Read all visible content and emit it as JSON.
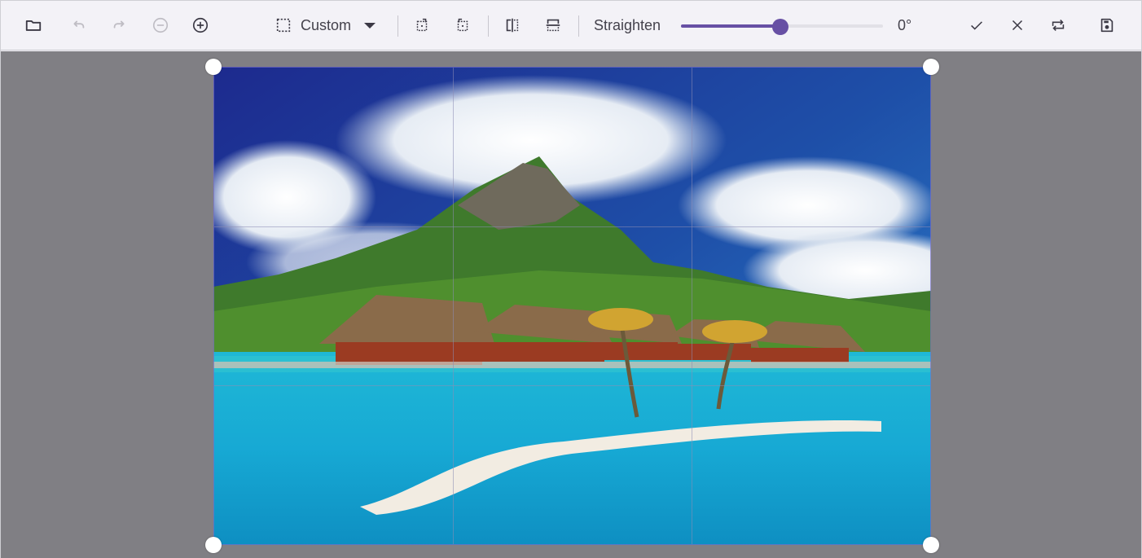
{
  "toolbar": {
    "open": {
      "icon": "folder-icon",
      "enabled": true
    },
    "undo": {
      "icon": "undo-icon",
      "enabled": false
    },
    "redo": {
      "icon": "redo-icon",
      "enabled": false
    },
    "zoom_out": {
      "icon": "zoom-out-icon",
      "enabled": false
    },
    "zoom_in": {
      "icon": "zoom-in-icon",
      "enabled": true
    },
    "aspect_ratio": {
      "icon": "crop-selection-icon",
      "selected": "Custom"
    },
    "rotate_left": {
      "icon": "rotate-left-icon"
    },
    "rotate_right": {
      "icon": "rotate-right-icon"
    },
    "flip_horizontal": {
      "icon": "flip-horizontal-icon"
    },
    "flip_vertical": {
      "icon": "flip-vertical-icon"
    },
    "straighten": {
      "label": "Straighten",
      "value_text": "0°",
      "slider_fraction": 0.49
    },
    "apply": {
      "icon": "check-icon"
    },
    "cancel": {
      "icon": "close-icon"
    },
    "reset": {
      "icon": "reset-icon"
    },
    "save": {
      "icon": "save-icon"
    }
  },
  "colors": {
    "accent": "#6750a4",
    "canvas_bg": "#807f84",
    "toolbar_bg": "#f3f2f7",
    "icon": "#3b3945"
  },
  "image": {
    "description": "Tropical lagoon with overwater bungalows, green mountain, white clouds, palm trees and sandbar",
    "grid": "rule-of-thirds"
  }
}
